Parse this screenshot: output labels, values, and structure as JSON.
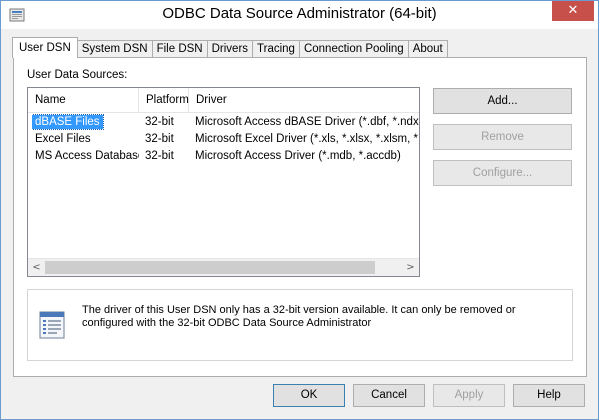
{
  "window": {
    "title": "ODBC Data Source Administrator (64-bit)",
    "close_glyph": "✕",
    "accent_color": "#6b9bd1"
  },
  "tabs": [
    {
      "label": "User DSN",
      "active": true
    },
    {
      "label": "System DSN",
      "active": false
    },
    {
      "label": "File DSN",
      "active": false
    },
    {
      "label": "Drivers",
      "active": false
    },
    {
      "label": "Tracing",
      "active": false
    },
    {
      "label": "Connection Pooling",
      "active": false
    },
    {
      "label": "About",
      "active": false
    }
  ],
  "user_dsn": {
    "section_label": "User Data Sources:",
    "columns": {
      "name": "Name",
      "platform": "Platform",
      "driver": "Driver"
    },
    "rows": [
      {
        "name": "dBASE Files",
        "platform": "32-bit",
        "driver": "Microsoft Access dBASE Driver (*.dbf, *.ndx, *.mdx)",
        "selected": true
      },
      {
        "name": "Excel Files",
        "platform": "32-bit",
        "driver": "Microsoft Excel Driver (*.xls, *.xlsx, *.xlsm, *.xlsb)",
        "selected": false
      },
      {
        "name": "MS Access Database",
        "platform": "32-bit",
        "driver": "Microsoft Access Driver (*.mdb, *.accdb)",
        "selected": false
      }
    ],
    "scroll_left": "<",
    "scroll_right": ">",
    "buttons": {
      "add": "Add...",
      "remove": "Remove",
      "configure": "Configure..."
    },
    "info_text": "The driver of this User DSN only has a 32-bit version available. It can only be removed or configured with the 32-bit ODBC Data Source Administrator"
  },
  "dialog_buttons": {
    "ok": "OK",
    "cancel": "Cancel",
    "apply": "Apply",
    "help": "Help"
  },
  "icons": {
    "app": "odbc-app-icon",
    "info": "document-list-icon"
  }
}
